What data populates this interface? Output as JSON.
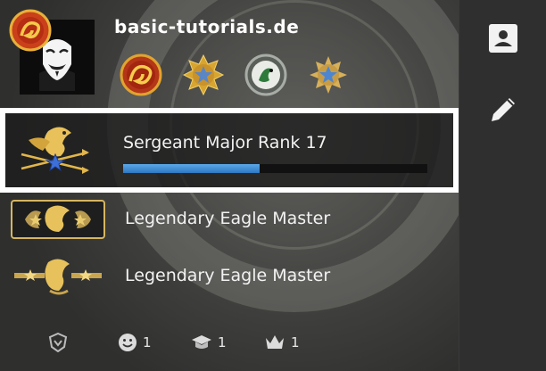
{
  "profile": {
    "username": "basic-tutorials.de",
    "medals": [
      {
        "icon": "golden-dragon-medal-icon"
      },
      {
        "icon": "star-service-medal-icon"
      },
      {
        "icon": "operation-coin-icon"
      },
      {
        "icon": "blue-star-service-medal-icon"
      }
    ]
  },
  "ranks": [
    {
      "name": "Sergeant Major Rank 17",
      "progress": 0.45,
      "icon": "eagle-arrows-rank-icon"
    },
    {
      "name": "Legendary Eagle Master",
      "icon": "legendary-eagle-master-icon"
    },
    {
      "name": "Legendary Eagle Master",
      "icon": "legendary-eagle-master-icon"
    }
  ],
  "stats": {
    "friendly": "1",
    "teacher": "1",
    "leader": "1"
  },
  "colors": {
    "progress": "#3a8ad6",
    "highlight_border": "#ffffff",
    "panel": "#2f2f2f"
  }
}
